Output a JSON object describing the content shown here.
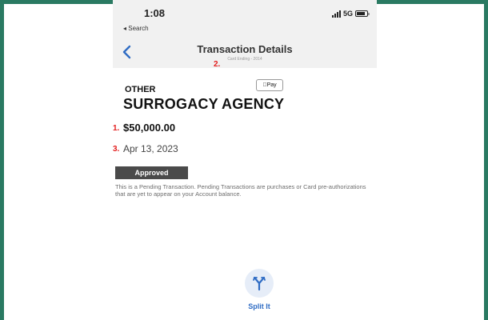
{
  "status_bar": {
    "time": "1:08",
    "back_app": "◂ Search",
    "network": "5G"
  },
  "nav": {
    "title": "Transaction Details",
    "subtitle": "Card Ending - 2014"
  },
  "wallet_badge": "Pay",
  "transaction": {
    "category": "OTHER",
    "merchant": "SURROGACY AGENCY",
    "amount": "$50,000.00",
    "date": "Apr 13, 2023",
    "status": "Approved",
    "notice": "This is a Pending Transaction. Pending Transactions are purchases or Card pre-authorizations that are yet to appear on your Account balance."
  },
  "annotations": {
    "amount_marker": "1.",
    "subtitle_marker": "2.",
    "date_marker": "3."
  },
  "actions": {
    "split_label": "Split It"
  },
  "colors": {
    "frame": "#2a7a62",
    "accent_blue": "#2f6cc4",
    "marker_red": "#e31d1d",
    "badge_bg": "#4a4a4a"
  }
}
